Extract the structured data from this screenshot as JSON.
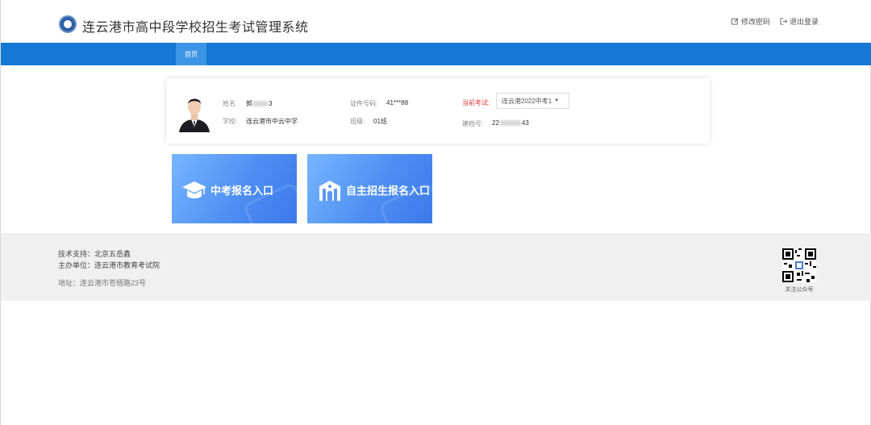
{
  "header": {
    "site_title": "连云港市高中段学校招生考试管理系统",
    "change_password": "修改密码",
    "logout": "退出登录"
  },
  "nav": {
    "home": "首页"
  },
  "student": {
    "name_label": "姓名:",
    "name_value_prefix": "郭",
    "name_value_suffix": "3",
    "school_label": "学校:",
    "school_value": "连云港市中云中学",
    "id_label": "证件号码:",
    "id_value": "41***88",
    "class_label": "班级:",
    "class_value": "01班",
    "exam_label": "当前考试:",
    "exam_value": "连云港2022中考1",
    "file_label": "建档号:",
    "file_value_prefix": "22",
    "file_value_suffix": "43"
  },
  "tiles": {
    "zhongkao": "中考报名入口",
    "zizhu": "自主招生报名入口"
  },
  "footer": {
    "tech_support": "技术支持：北京五岳鑫",
    "organizer": "主办单位：连云港市教育考试院",
    "address": "地址：连云港市苍梧路23号",
    "qr_label": "关注公众号"
  },
  "colors": {
    "nav_blue": "#1478d4",
    "nav_active": "#3d94e6",
    "tile_gradient_start": "#76b6ff",
    "tile_gradient_end": "#3b79ea",
    "exam_label_red": "#e23b3b"
  },
  "icons": [
    "logo-emblem",
    "edit-icon",
    "logout-icon",
    "graduation-cap-icon",
    "school-building-icon",
    "qr-code"
  ]
}
